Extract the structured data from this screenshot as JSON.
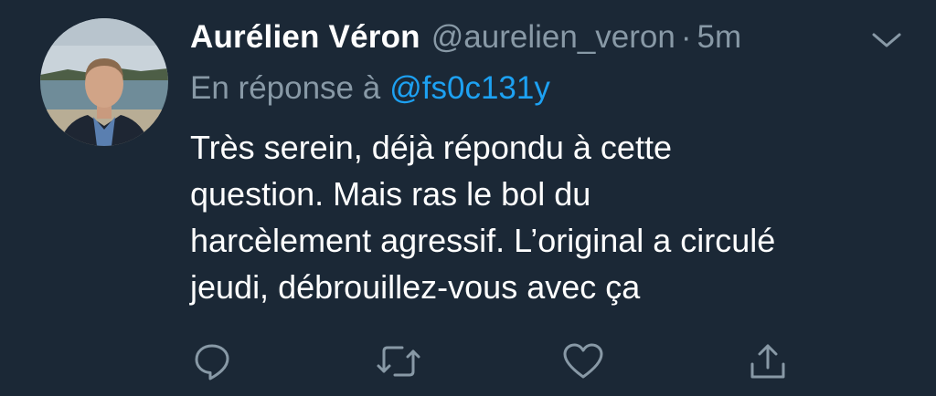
{
  "tweet": {
    "author_name": "Aurélien Véron",
    "handle": "@aurelien_veron",
    "separator": "·",
    "time": "5m",
    "reply_prefix": "En réponse à",
    "reply_mention": "@fs0c131y",
    "body_lines": [
      "Très serein, déjà répondu à cette",
      "question. Mais ras le bol du",
      "harcèlement agressif. L’original a circulé",
      "jeudi, débrouillez-vous avec ça"
    ]
  },
  "icons": {
    "avatar": "avatar-photo",
    "menu": "chevron-down-icon",
    "reply": "reply-icon",
    "retweet": "retweet-icon",
    "like": "heart-icon",
    "share": "share-icon"
  },
  "colors": {
    "background": "#1b2836",
    "text": "#ffffff",
    "secondary": "#8899a6",
    "link": "#1da1f2"
  }
}
